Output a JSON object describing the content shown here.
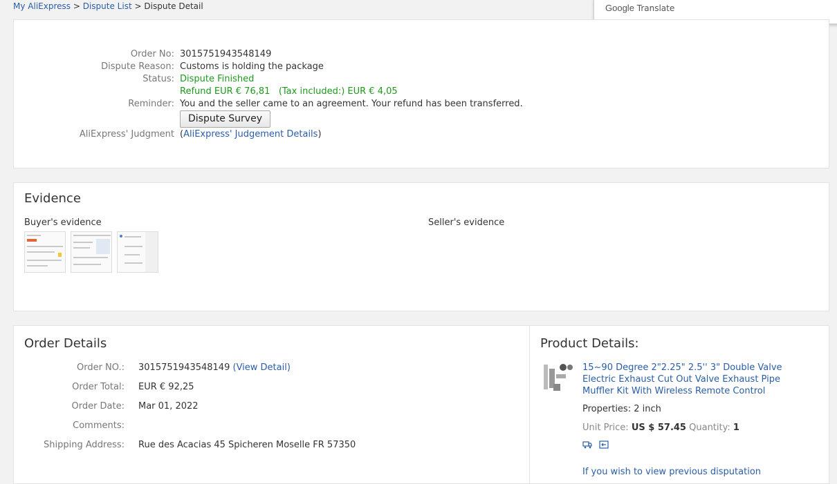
{
  "breadcrumb": {
    "items": [
      "My AliExpress",
      "Dispute List"
    ],
    "separator": ">",
    "current": "Dispute Detail"
  },
  "translate_popup": {
    "brand": "Google",
    "label": "Translate"
  },
  "dispute": {
    "order_no_label": "Order No:",
    "order_no": "3015751943548149",
    "reason_label": "Dispute Reason:",
    "reason": "Customs is holding the package",
    "status_label": "Status:",
    "status": "Dispute Finished",
    "refund": "Refund EUR € 76,81",
    "tax": "(Tax included:) EUR € 4,05",
    "reminder_label": "Reminder:",
    "reminder": "You and the seller came to an agreement. Your refund has been transferred.",
    "survey_button": "Dispute Survey",
    "judgment_label": "AliExpress' Judgment",
    "judgment_open": "(",
    "judgment_link": "AliExpress' Judgement Details",
    "judgment_close": ")"
  },
  "evidence": {
    "title": "Evidence",
    "buyer_label": "Buyer's evidence",
    "seller_label": "Seller's evidence"
  },
  "order_details": {
    "title": "Order Details",
    "order_no_label": "Order NO.:",
    "order_no": "3015751943548149",
    "view_detail_open": "(",
    "view_detail": "View Detail",
    "view_detail_close": ")",
    "total_label": "Order Total:",
    "total": "EUR € 92,25",
    "date_label": "Order Date:",
    "date": "Mar 01, 2022",
    "comments_label": "Comments:",
    "comments": "",
    "shipping_label": "Shipping Address:",
    "shipping": "Rue des Acacias 45 Spicheren Moselle FR 57350"
  },
  "product_details": {
    "title": "Product Details:",
    "name_line1": "15~90 Degree 2\"2.25\" 2.5'' 3\" Double Valve",
    "name_line2": "Electric Exhaust Cut Out Valve Exhaust Pipe",
    "name_line3": "Muffler Kit With Wireless Remote Control",
    "properties": "Properties: 2 inch",
    "unit_price_label": "Unit Price:",
    "unit_price": "US $ 57.45",
    "quantity_label": "Quantity:",
    "quantity": "1",
    "previous_link": "If you wish to view previous disputation"
  }
}
